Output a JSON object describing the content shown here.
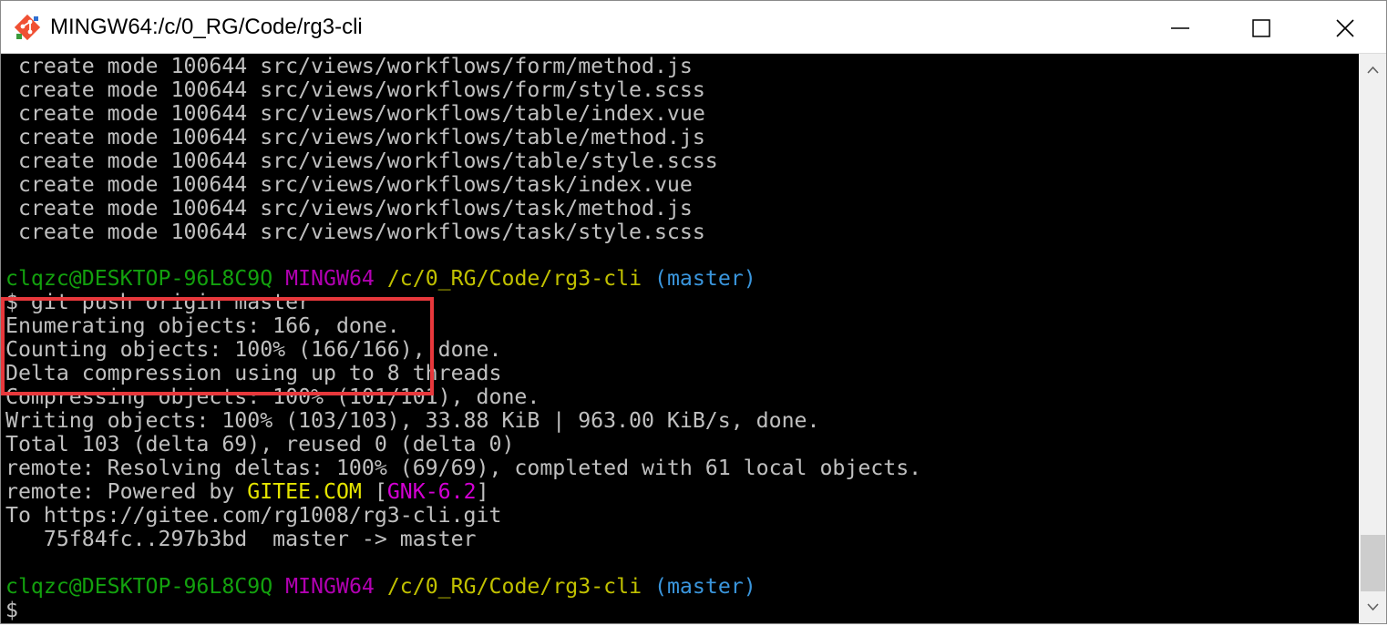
{
  "window": {
    "title": "MINGW64:/c/0_RG/Code/rg3-cli",
    "minimize_label": "",
    "maximize_label": "",
    "close_label": ""
  },
  "icons": {
    "app": "git-bash-icon",
    "minimize": "minimize-icon",
    "maximize": "maximize-icon",
    "close": "close-icon",
    "scroll_up": "chevron-up-icon",
    "scroll_down": "chevron-down-icon"
  },
  "colors": {
    "terminal_bg": "#000000",
    "text": "#c0c0c0",
    "user_host": "#13a10e",
    "shell_name": "#b200b2",
    "path": "#c1c100",
    "branch": "#3a96dd",
    "gitee": "#e5e500",
    "gnk": "#d400d4",
    "highlight": "#e8383c"
  },
  "terminal": {
    "create_lines": [
      " create mode 100644 src/views/workflows/form/method.js",
      " create mode 100644 src/views/workflows/form/style.scss",
      " create mode 100644 src/views/workflows/table/index.vue",
      " create mode 100644 src/views/workflows/table/method.js",
      " create mode 100644 src/views/workflows/table/style.scss",
      " create mode 100644 src/views/workflows/task/index.vue",
      " create mode 100644 src/views/workflows/task/method.js",
      " create mode 100644 src/views/workflows/task/style.scss"
    ],
    "prompt1": {
      "user_host": "clqzc@DESKTOP-96L8C9Q",
      "shell": "MINGW64",
      "path": "/c/0_RG/Code/rg3-cli",
      "branch": "(master)"
    },
    "command": "$ git push origin master",
    "output": [
      "Enumerating objects: 166, done.",
      "Counting objects: 100% (166/166), done.",
      "Delta compression using up to 8 threads",
      "Compressing objects: 100% (101/101), done.",
      "Writing objects: 100% (103/103), 33.88 KiB | 963.00 KiB/s, done.",
      "Total 103 (delta 69), reused 0 (delta 0)",
      "remote: Resolving deltas: 100% (69/69), completed with 61 local objects."
    ],
    "remote_powered": {
      "prefix": "remote: Powered by ",
      "gitee": "GITEE.COM",
      "space": " ",
      "bracket_open": "[",
      "gnk": "GNK-6.2",
      "bracket_close": "]"
    },
    "to_line": "To https://gitee.com/rg1008/rg3-cli.git",
    "ref_line": "   75f84fc..297b3bd  master -> master",
    "prompt2": {
      "user_host": "clqzc@DESKTOP-96L8C9Q",
      "shell": "MINGW64",
      "path": "/c/0_RG/Code/rg3-cli",
      "branch": "(master)"
    },
    "cursor_prompt": "$"
  }
}
